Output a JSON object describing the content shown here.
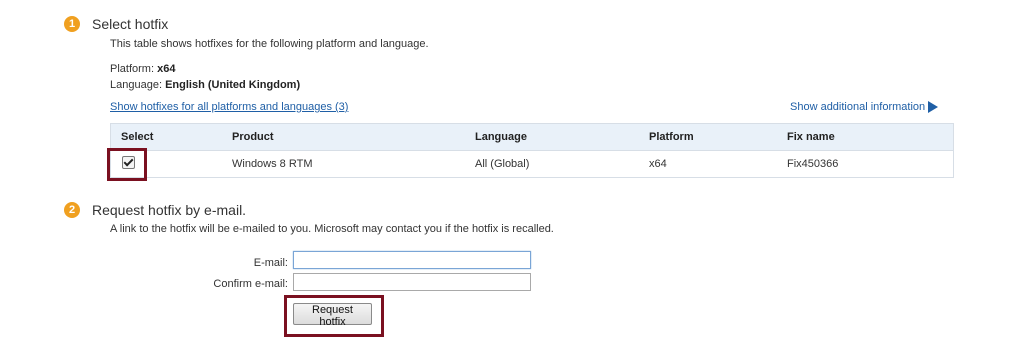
{
  "step1": {
    "number": "1",
    "title": "Select hotfix",
    "description": "This table shows hotfixes for the following platform and language.",
    "platform_label": "Platform:",
    "platform_value": "x64",
    "language_label": "Language:",
    "language_value": "English (United Kingdom)",
    "show_all_link": "Show hotfixes for all platforms and languages (3)",
    "show_additional": "Show additional information"
  },
  "table": {
    "headers": [
      "Select",
      "Product",
      "Language",
      "Platform",
      "Fix name"
    ],
    "rows": [
      {
        "selected": true,
        "product": "Windows 8 RTM",
        "language": "All (Global)",
        "platform": "x64",
        "fix_name": "Fix450366"
      }
    ]
  },
  "step2": {
    "number": "2",
    "title": "Request hotfix by e-mail.",
    "description": "A link to the hotfix will be e-mailed to you. Microsoft may contact you if the hotfix is recalled.",
    "email_label": "E-mail:",
    "email_value": "",
    "confirm_label": "Confirm e-mail:",
    "confirm_value": "",
    "button_label": "Request hotfix"
  }
}
